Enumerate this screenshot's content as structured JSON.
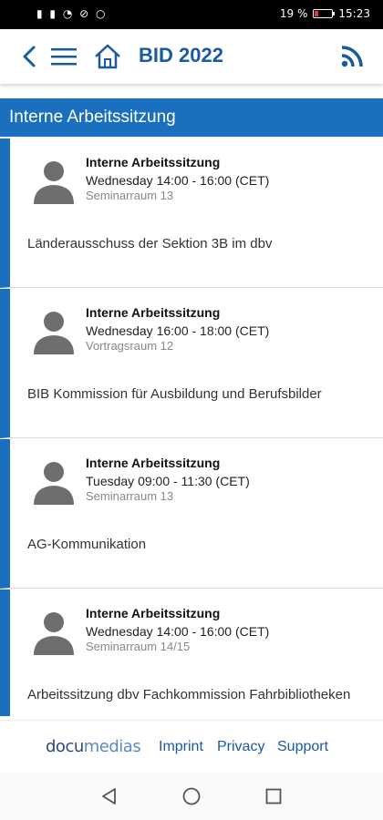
{
  "statusbar": {
    "left_icons": "▮ ▮ ◔ ⊘ ○",
    "battery_percent": "19 %",
    "time": "15:23"
  },
  "appbar": {
    "title": "BID 2022",
    "icons": [
      "back-icon",
      "menu-icon",
      "home-icon",
      "rss-icon"
    ]
  },
  "section": {
    "title": "Interne Arbeitssitzung"
  },
  "sessions": [
    {
      "type": "Interne Arbeitssitzung",
      "time": "Wednesday 14:00 - 16:00 (CET)",
      "room": "Seminarraum 13",
      "description": "Länderausschuss der Sektion 3B im dbv"
    },
    {
      "type": "Interne Arbeitssitzung",
      "time": "Wednesday 16:00 - 18:00 (CET)",
      "room": "Vortragsraum 12",
      "description": "BIB Kommission für Ausbildung und Berufsbilder"
    },
    {
      "type": "Interne Arbeitssitzung",
      "time": "Tuesday 09:00 - 11:30 (CET)",
      "room": "Seminarraum 13",
      "description": "AG-Kommunikation"
    },
    {
      "type": "Interne Arbeitssitzung",
      "time": "Wednesday 14:00 - 16:00 (CET)",
      "room": "Seminarraum 14/15",
      "description": "Arbeitssitzung dbv Fachkommission Fahrbibliotheken"
    }
  ],
  "footer": {
    "logo_docu": "docu",
    "logo_media": "medias",
    "imprint": "Imprint",
    "privacy": "Privacy",
    "support": "Support"
  },
  "colors": {
    "accent": "#1b6fbf",
    "title_blue": "#1a5aa0",
    "avatar_gray": "#6e6e6e"
  }
}
